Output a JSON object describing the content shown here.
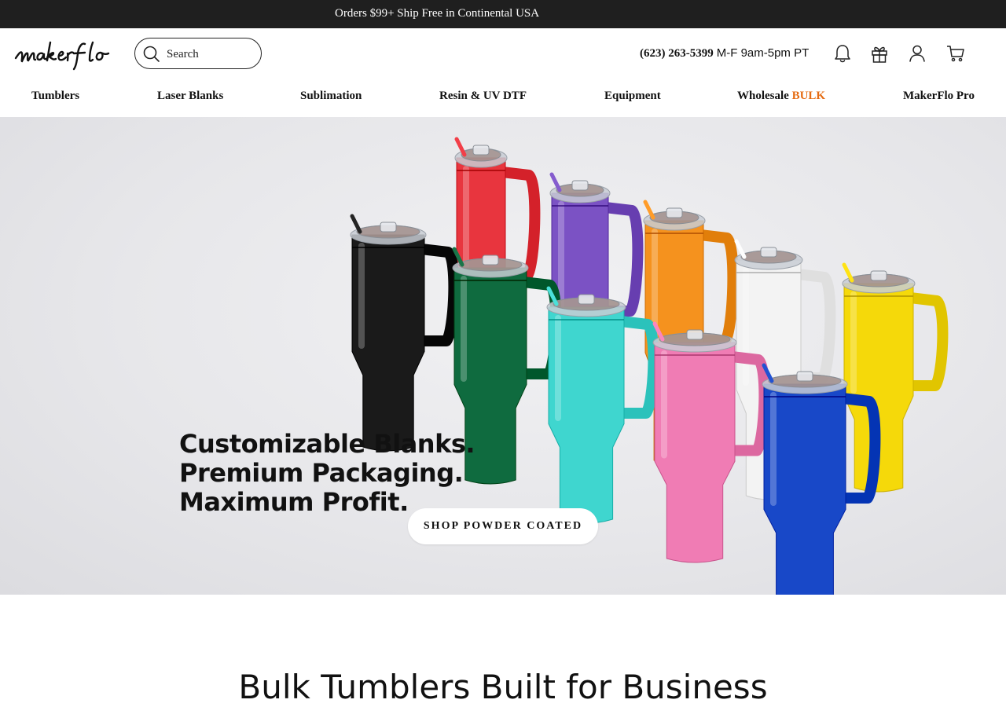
{
  "announcement": {
    "text": "Orders $99+ Ship Free in Continental USA"
  },
  "header": {
    "logo_text": "makerflo",
    "search": {
      "placeholder": "Search",
      "value": ""
    },
    "phone": "(623) 263-5399",
    "hours": "M-F 9am-5pm PT",
    "icons": [
      "bell-icon",
      "gift-icon",
      "user-icon",
      "cart-icon"
    ]
  },
  "nav": {
    "items": [
      {
        "label": "Tumblers"
      },
      {
        "label": "Laser Blanks"
      },
      {
        "label": "Sublimation"
      },
      {
        "label": "Resin & UV DTF"
      },
      {
        "label": "Equipment"
      },
      {
        "label": "Wholesale ",
        "accent": "BULK"
      },
      {
        "label": "MakerFlo Pro"
      }
    ]
  },
  "hero": {
    "headline": [
      "Customizable Blanks.",
      "Premium Packaging.",
      "Maximum Profit."
    ],
    "cta_label": "SHOP POWDER COATED",
    "tumbler_colors": [
      "#e8353e",
      "#7b52c4",
      "#f5921e",
      "#1a1a1a",
      "#0f6b3f",
      "#f3f3f3",
      "#f5d90a",
      "#3fd6cf",
      "#f07cb4",
      "#1848c8"
    ]
  },
  "section": {
    "title": "Bulk Tumblers Built for Business"
  },
  "colors": {
    "announce_bg": "#1f1f1f",
    "accent": "#e56b12"
  }
}
